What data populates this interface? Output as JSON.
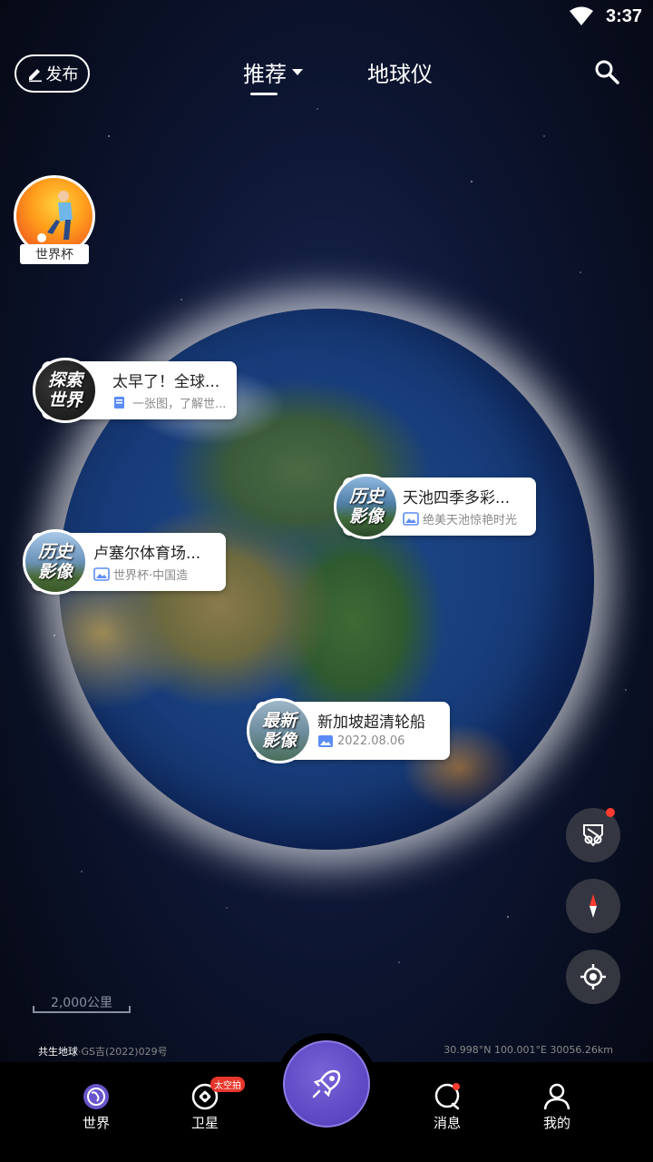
{
  "status_bar": {
    "time": "3:37"
  },
  "header": {
    "publish_label": "发布",
    "tabs": [
      {
        "label": "推荐",
        "active": true
      },
      {
        "label": "地球仪",
        "active": false
      }
    ]
  },
  "topic": {
    "label": "世界杯"
  },
  "cards": [
    {
      "thumb_text": [
        "探索",
        "世界"
      ],
      "title": "太早了！全球...",
      "subtitle": "一张图，了解世..."
    },
    {
      "thumb_text": [
        "历史",
        "影像"
      ],
      "title": "天池四季多彩...",
      "subtitle": "绝美天池惊艳时光"
    },
    {
      "thumb_text": [
        "历史",
        "影像"
      ],
      "title": "卢塞尔体育场...",
      "subtitle": "世界杯·中国造"
    },
    {
      "thumb_text": [
        "最新",
        "影像"
      ],
      "title": "新加坡超清轮船",
      "subtitle": "2022.08.06"
    }
  ],
  "side_buttons": [
    "satellite-view-icon",
    "compass-icon",
    "locate-icon"
  ],
  "map": {
    "scale_label": "2,000公里",
    "copyright_brand": "共生地球",
    "copyright_license": "·GS吉(2022)029号",
    "coords": "30.998°N 100.001°E 30056.26km"
  },
  "bottom_nav": {
    "items": [
      {
        "label": "世界",
        "icon": "globe-icon"
      },
      {
        "label": "卫星",
        "icon": "satellite-icon",
        "badge": "太空拍"
      },
      {
        "label": "消息",
        "icon": "message-icon"
      },
      {
        "label": "我的",
        "icon": "profile-icon"
      }
    ],
    "center_icon": "rocket-icon"
  },
  "colors": {
    "accent": "#6a55cc",
    "badge_red": "#e8362b"
  }
}
